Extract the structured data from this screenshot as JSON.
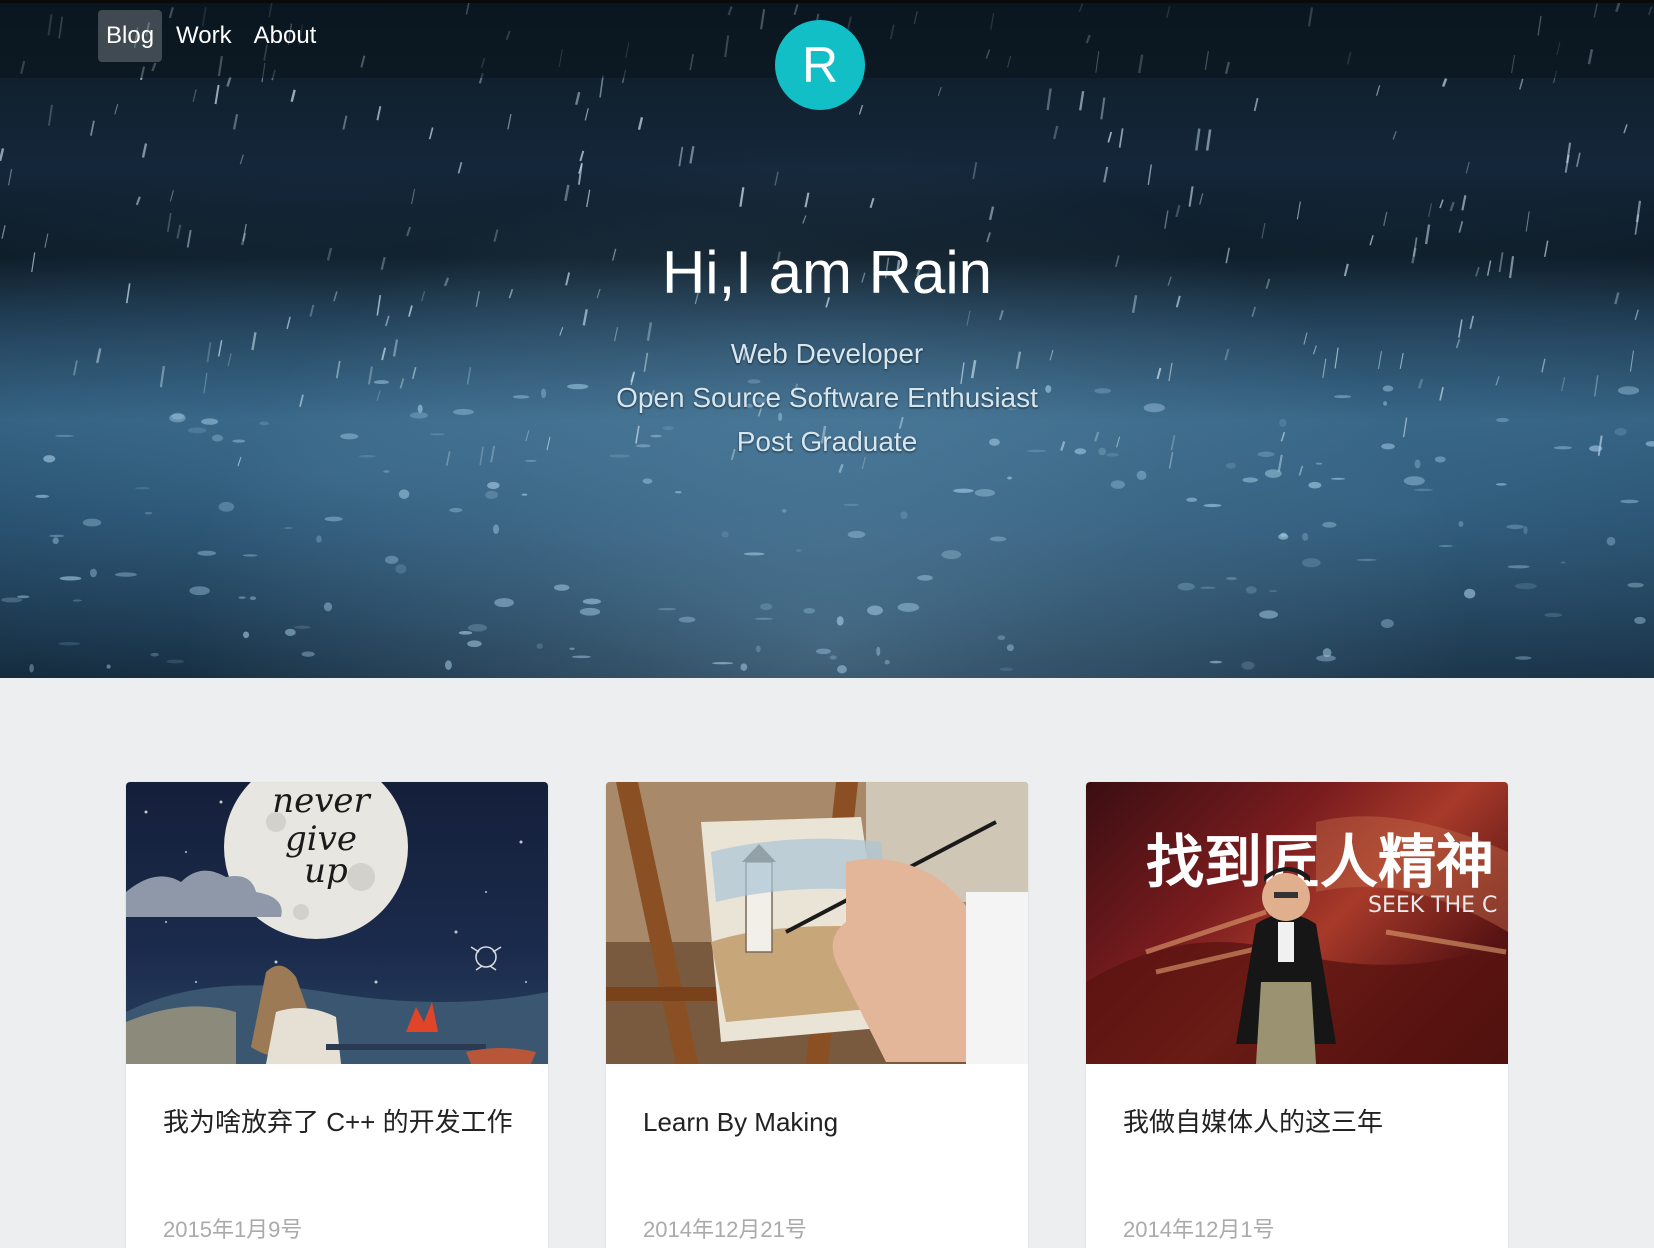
{
  "nav": {
    "items": [
      {
        "label": "Blog",
        "active": true
      },
      {
        "label": "Work",
        "active": false
      },
      {
        "label": "About",
        "active": false
      }
    ]
  },
  "logo": {
    "letter": "R",
    "color": "#12bfc7"
  },
  "hero": {
    "title": "Hi,I am Rain",
    "lines": [
      "Web Developer",
      "Open Source Software Enthusiast",
      "Post Graduate"
    ]
  },
  "posts": [
    {
      "title": "我为啥放弃了 C++ 的开发工作",
      "date": "2015年1月9号",
      "image_text": "never give up"
    },
    {
      "title": "Learn By Making",
      "date": "2014年12月21号"
    },
    {
      "title": "我做自媒体人的这三年",
      "date": "2014年12月1号",
      "image_text": "找到匠人精神",
      "image_subtext": "SEEK THE C"
    }
  ]
}
